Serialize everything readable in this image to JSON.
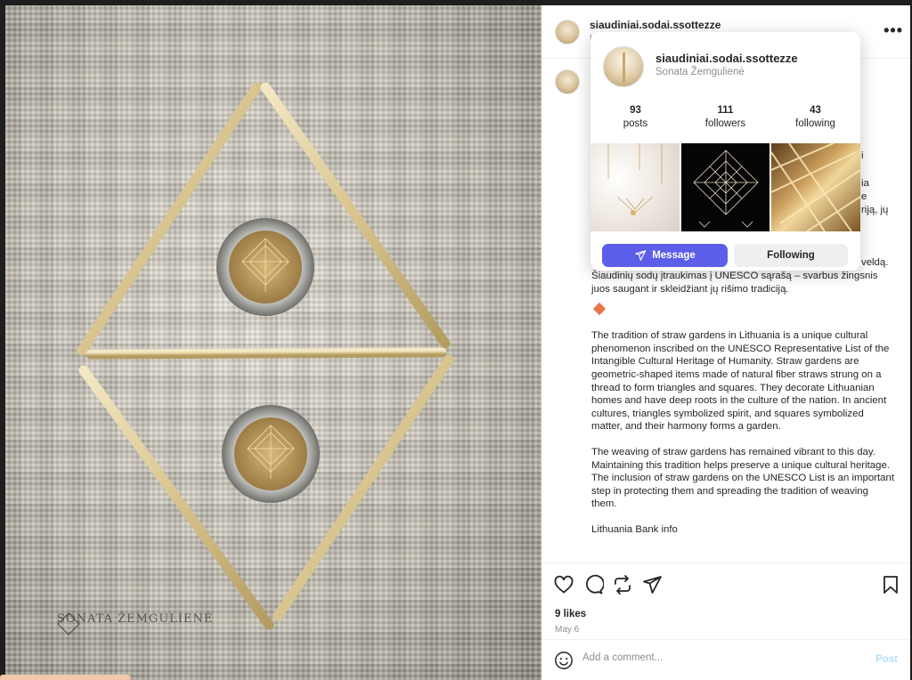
{
  "post": {
    "username": "siaudiniai.sodai.ssottezze",
    "header_peek": "L",
    "caption_peek_1": "i",
    "caption_peek_2": "ia",
    "caption_peek_3": "e",
    "caption_peek_4": "riją, jų",
    "caption_peek_5": "veldą.",
    "caption_lt_line1": "Šiaudinių sodų įtraukimas į UNESCO sąrašą – svarbus žingsnis",
    "caption_lt_line2": "juos saugant ir skleidžiant jų rišimo tradiciją.",
    "caption_en_p1": "The tradition of straw gardens in Lithuania is a unique cultural phenomenon inscribed on the UNESCO Representative List of the Intangible Cultural Heritage of Humanity. Straw gardens are geometric-shaped items made of natural fiber straws strung on a thread to form triangles and squares. They decorate Lithuanian homes and have deep roots in the culture of the nation. In ancient cultures, triangles symbolized spirit, and squares symbolized matter, and their harmony forms a garden.",
    "caption_en_p2": "The weaving of straw gardens has remained vibrant to this day. Maintaining this tradition helps preserve a unique cultural heritage. The inclusion of straw gardens on the UNESCO List is an important step in protecting them and spreading the tradition of weaving them.",
    "caption_en_p3": "Lithuania Bank info",
    "likes": "9 likes",
    "date": "May 6",
    "more_label": "•••"
  },
  "comment": {
    "placeholder": "Add a comment...",
    "post_label": "Post"
  },
  "hover_card": {
    "username": "siaudiniai.sodai.ssottezze",
    "full_name": "Sonata Žemgulienė",
    "stats": [
      {
        "num": "93",
        "label": "posts"
      },
      {
        "num": "111",
        "label": "followers"
      },
      {
        "num": "43",
        "label": "following"
      }
    ],
    "message_label": "Message",
    "following_label": "Following"
  },
  "photo": {
    "watermark": "SONATA ŽEMGULIENĖ"
  },
  "colors": {
    "accent": "#5b5ee8",
    "diamond": "#e8744a",
    "post_link": "#b2dffc"
  },
  "icons": [
    "heart-icon",
    "comment-icon",
    "repost-icon",
    "share-icon",
    "bookmark-icon",
    "emoji-icon",
    "send-icon"
  ]
}
